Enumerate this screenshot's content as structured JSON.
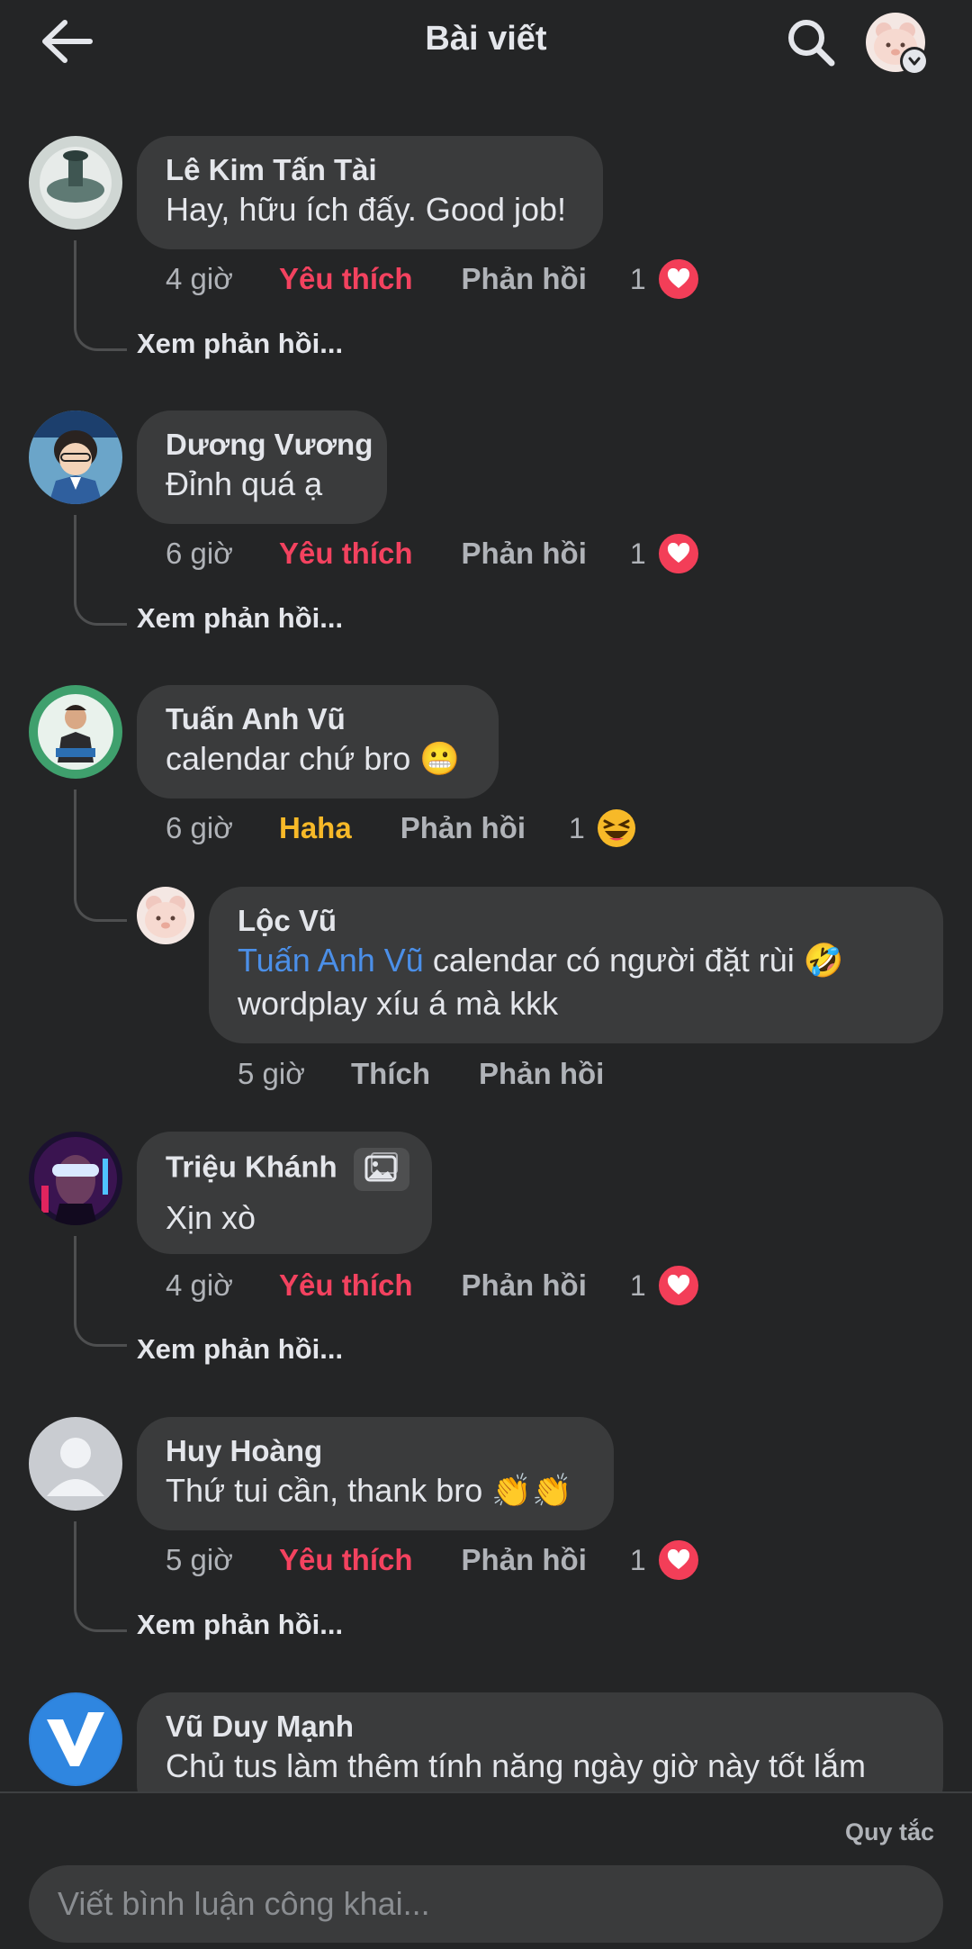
{
  "header": {
    "title": "Bài viết",
    "back_icon": "arrow-left-icon",
    "search_icon": "search-icon"
  },
  "colors": {
    "background": "#242526",
    "bubble": "#3a3b3c",
    "love": "#f3425f",
    "haha": "#f7b928",
    "mention": "#4b8fe8"
  },
  "comments": [
    {
      "author": "Lê Kim Tấn Tài",
      "text": "Hay, hữu ích đấy. Good job!",
      "time": "4 giờ",
      "reaction_label": "Yêu thích",
      "reply_label": "Phản hồi",
      "reaction_count": "1",
      "reaction_icon": "heart-icon",
      "view_replies": "Xem phản hồi..."
    },
    {
      "author": "Dương Vương",
      "text": "Đỉnh quá ạ",
      "time": "6 giờ",
      "reaction_label": "Yêu thích",
      "reply_label": "Phản hồi",
      "reaction_count": "1",
      "reaction_icon": "heart-icon",
      "view_replies": "Xem phản hồi..."
    },
    {
      "author": "Tuấn Anh Vũ",
      "text": "calendar chứ bro 😬",
      "time": "6 giờ",
      "reaction_label": "Haha",
      "reply_label": "Phản hồi",
      "reaction_count": "1",
      "reaction_icon": "haha-icon",
      "reply": {
        "author": "Lộc Vũ",
        "mention": "Tuấn Anh Vũ",
        "text_line1": " calendar có người đặt rùi 🤣",
        "text_line2": "wordplay xíu á mà kkk",
        "time": "5 giờ",
        "like_label": "Thích",
        "reply_label": "Phản hồi"
      }
    },
    {
      "author": "Triệu Khánh",
      "text": "Xịn xò",
      "time": "4 giờ",
      "reaction_label": "Yêu thích",
      "reply_label": "Phản hồi",
      "reaction_count": "1",
      "reaction_icon": "heart-icon",
      "view_replies": "Xem phản hồi..."
    },
    {
      "author": "Huy Hoàng",
      "text": "Thứ tui cần, thank bro 👏👏",
      "time": "5 giờ",
      "reaction_label": "Yêu thích",
      "reply_label": "Phản hồi",
      "reaction_count": "1",
      "reaction_icon": "heart-icon",
      "view_replies": "Xem phản hồi..."
    },
    {
      "author": "Vũ Duy Mạnh",
      "text": "Chủ tus làm thêm tính năng ngày giờ này tốt lắm"
    }
  ],
  "footer": {
    "rules_label": "Quy tắc",
    "composer_placeholder": "Viết bình luận công khai..."
  }
}
